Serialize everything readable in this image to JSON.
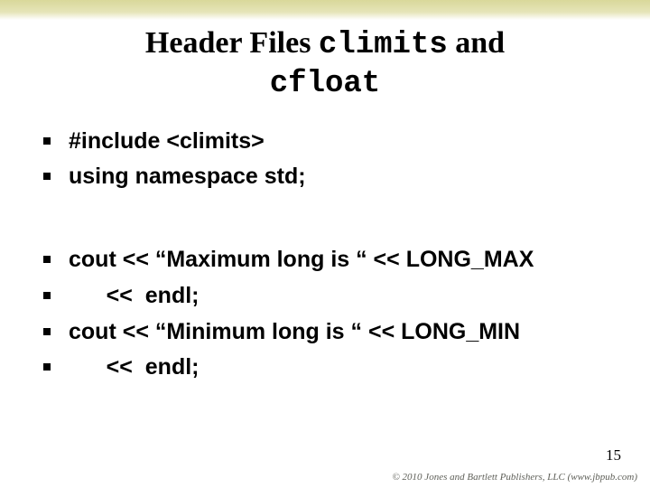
{
  "title": {
    "part1": "Header Files ",
    "mono1": "climits",
    "part2": " and",
    "mono2": "cfloat"
  },
  "bullets": [
    "#include  <climits>",
    "using  namespace  std;",
    "cout  <<  “Maximum long is “  << LONG_MAX",
    "      <<  endl;",
    "cout  <<  “Minimum long is “  << LONG_MIN",
    "      <<  endl;"
  ],
  "page_number": "15",
  "copyright": "© 2010 Jones and Bartlett Publishers, LLC (www.jbpub.com)"
}
